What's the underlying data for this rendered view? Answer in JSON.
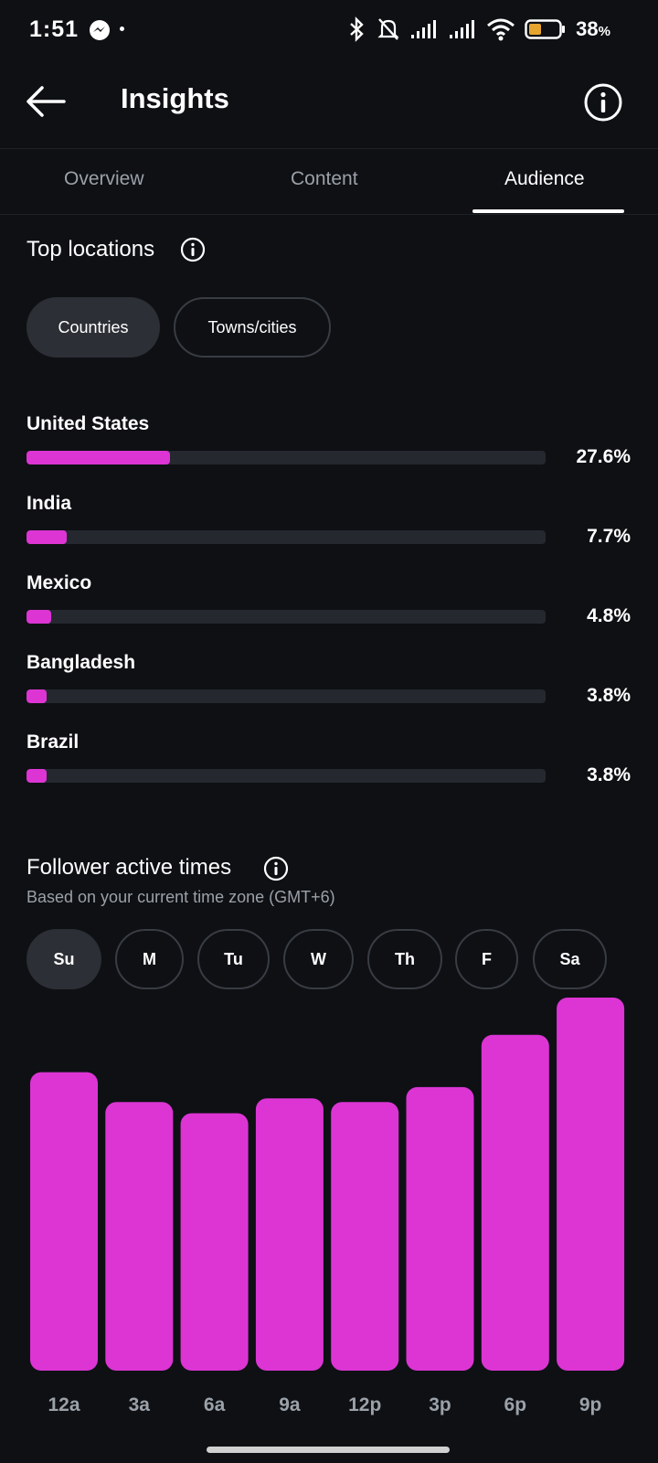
{
  "status_bar": {
    "time": "1:51",
    "battery_percent": "38",
    "battery_unit": "%",
    "icons": [
      "messenger-icon",
      "bluetooth-icon",
      "mute-icon",
      "signal-icon",
      "signal-icon",
      "wifi-icon",
      "battery-icon"
    ]
  },
  "header": {
    "title": "Insights"
  },
  "tabs": [
    {
      "label": "Overview",
      "active": false
    },
    {
      "label": "Content",
      "active": false
    },
    {
      "label": "Audience",
      "active": true
    }
  ],
  "top_locations": {
    "title": "Top locations",
    "filters": [
      {
        "label": "Countries",
        "active": true
      },
      {
        "label": "Towns/cities",
        "active": false
      }
    ],
    "items": [
      {
        "name": "United States",
        "percent_label": "27.6%",
        "value": 27.6
      },
      {
        "name": "India",
        "percent_label": "7.7%",
        "value": 7.7
      },
      {
        "name": "Mexico",
        "percent_label": "4.8%",
        "value": 4.8
      },
      {
        "name": "Bangladesh",
        "percent_label": "3.8%",
        "value": 3.8
      },
      {
        "name": "Brazil",
        "percent_label": "3.8%",
        "value": 3.8
      }
    ]
  },
  "active_times": {
    "title": "Follower active times",
    "subtitle": "Based on your current time zone (GMT+6)",
    "days": [
      {
        "label": "Su",
        "active": true
      },
      {
        "label": "M",
        "active": false
      },
      {
        "label": "Tu",
        "active": false
      },
      {
        "label": "W",
        "active": false
      },
      {
        "label": "Th",
        "active": false
      },
      {
        "label": "F",
        "active": false
      },
      {
        "label": "Sa",
        "active": false
      }
    ]
  },
  "colors": {
    "accent": "#dc35d4",
    "background": "#0e1014",
    "track": "#25282e"
  },
  "chart_data": {
    "type": "bar",
    "categories": [
      "12a",
      "3a",
      "6a",
      "9a",
      "12p",
      "3p",
      "6p",
      "9p"
    ],
    "values": [
      80,
      72,
      69,
      73,
      72,
      76,
      90,
      100
    ],
    "ylim": [
      0,
      100
    ],
    "grid": false,
    "xlabel": "",
    "ylabel": ""
  }
}
